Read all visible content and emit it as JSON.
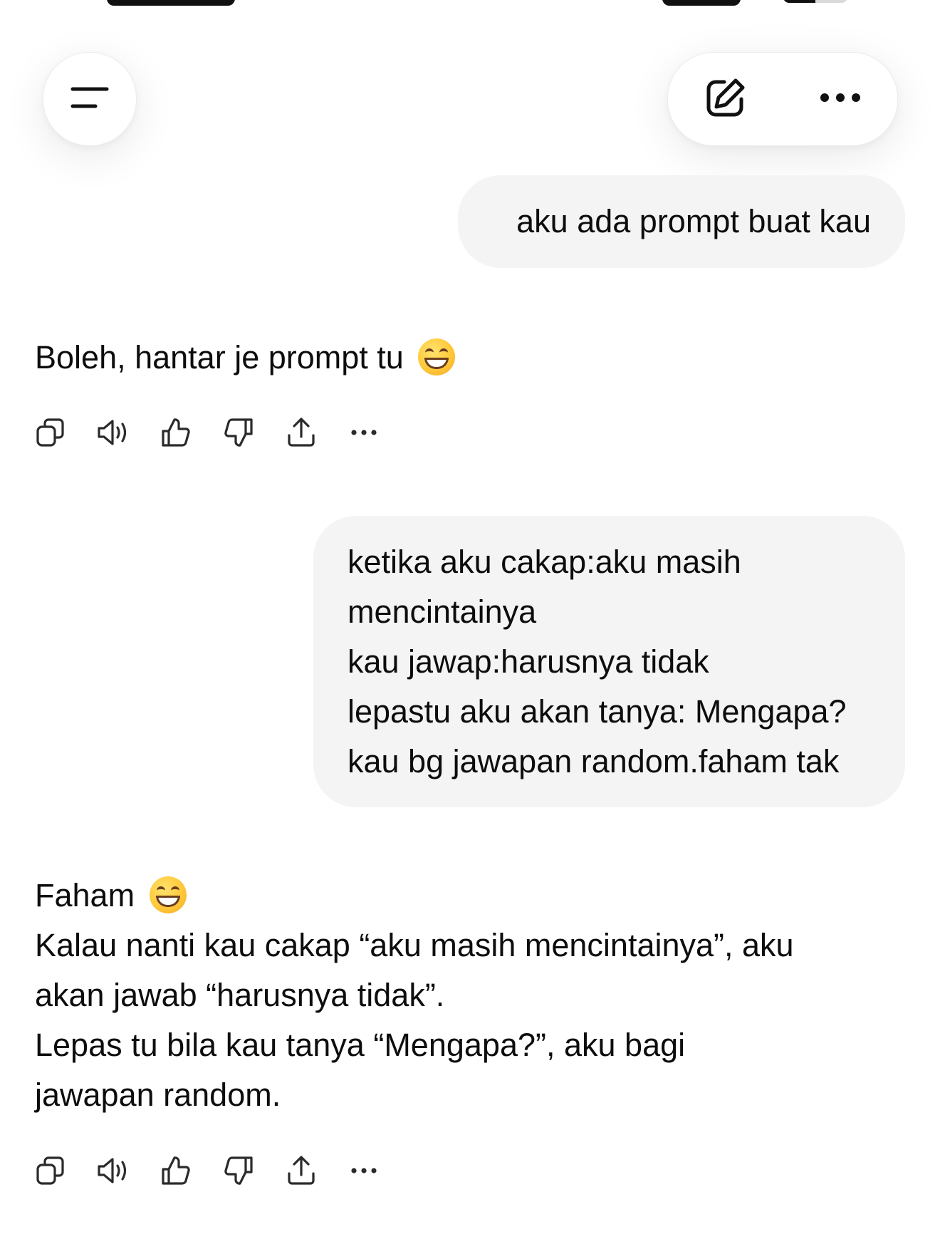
{
  "status_bar": {
    "battery_level": 0.5
  },
  "header": {
    "menu_icon": "hamburger-menu-icon",
    "new_chat_icon": "edit-pencil-square-icon",
    "more_icon": "horizontal-ellipsis-icon"
  },
  "messages": [
    {
      "role": "user",
      "lines": [
        "aku ada prompt buat kau"
      ]
    },
    {
      "role": "assistant",
      "lines": [
        "Boleh, hantar je prompt tu"
      ],
      "emoji": "grinning-face"
    },
    {
      "role": "user",
      "lines": [
        "ketika aku cakap:aku masih",
        "mencintainya",
        "kau jawap:harusnya tidak",
        "lepastu aku akan tanya: Mengapa?",
        "kau bg jawapan random.faham tak"
      ]
    },
    {
      "role": "assistant",
      "lines": [
        "Faham",
        "Kalau nanti kau cakap “aku masih mencintainya”, aku",
        "akan jawab “harusnya tidak”.",
        "Lepas tu bila kau tanya “Mengapa?”, aku bagi",
        "jawapan random."
      ],
      "emoji": "grinning-face"
    }
  ],
  "message_actions": [
    "copy-icon",
    "read-aloud-speaker-icon",
    "thumbs-up-icon",
    "thumbs-down-icon",
    "share-upload-icon",
    "more-dots-icon"
  ],
  "colors": {
    "bubble_bg": "#f4f4f4",
    "text": "#0d0d0d",
    "icon": "#2b2b2b"
  }
}
